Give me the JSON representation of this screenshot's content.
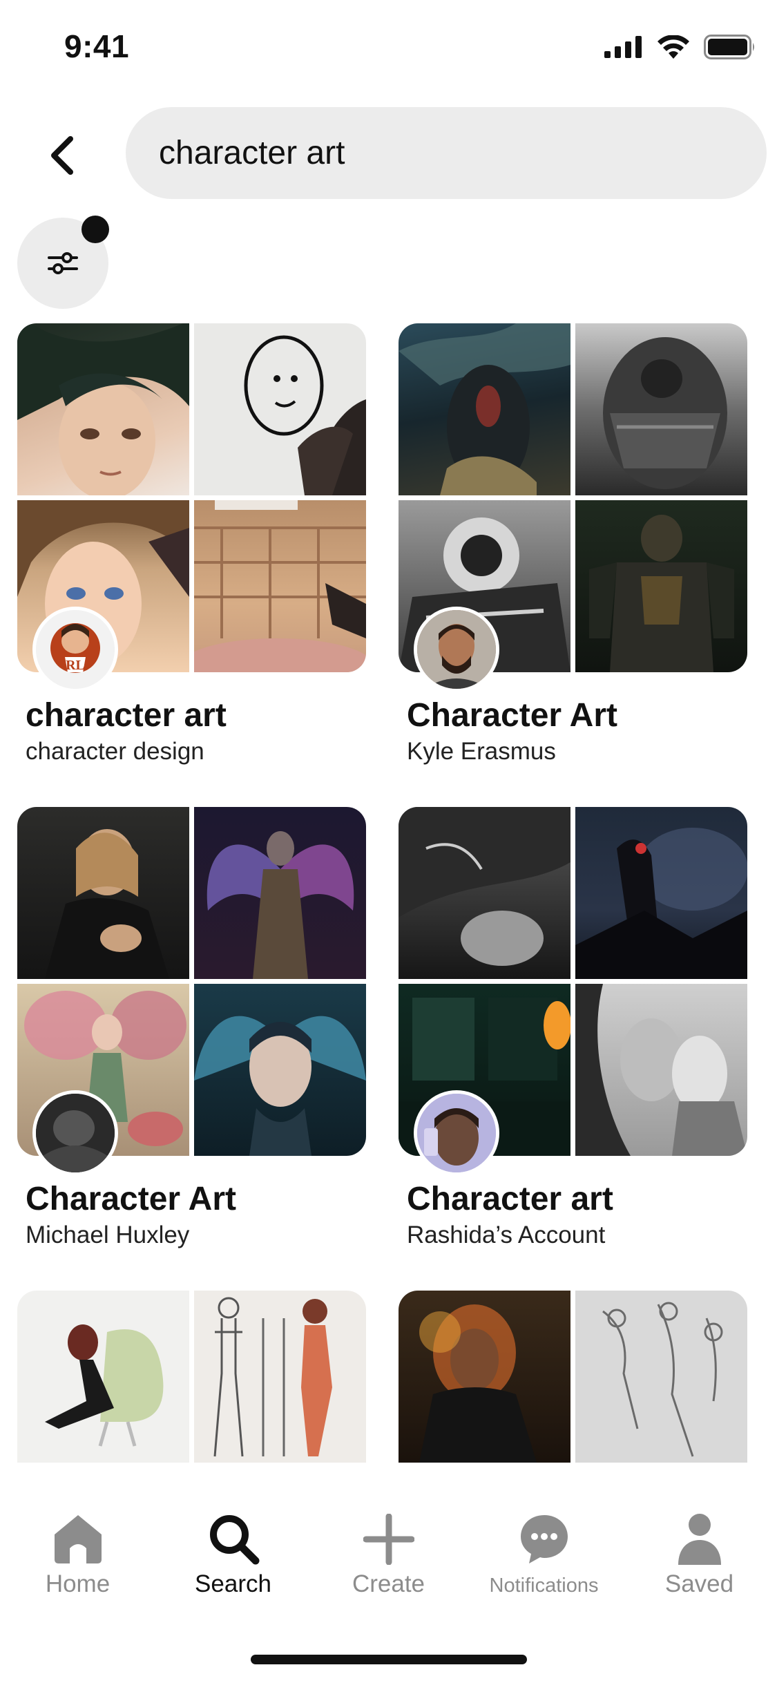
{
  "status_bar": {
    "time": "9:41"
  },
  "search": {
    "query": "character art"
  },
  "boards": [
    {
      "title": "character art",
      "subtitle": "character design"
    },
    {
      "title": "Character Art",
      "subtitle": "Kyle Erasmus"
    },
    {
      "title": "Character Art",
      "subtitle": "Michael Huxley"
    },
    {
      "title": "Character art",
      "subtitle": "Rashida’s Account"
    },
    {
      "title": "",
      "subtitle": ""
    },
    {
      "title": "",
      "subtitle": ""
    }
  ],
  "tab_bar": {
    "items": [
      {
        "label": "Home",
        "icon": "home-icon",
        "active": false
      },
      {
        "label": "Search",
        "icon": "search-icon",
        "active": true
      },
      {
        "label": "Create",
        "icon": "plus-icon",
        "active": false
      },
      {
        "label": "Notifications",
        "icon": "chat-bubble-icon",
        "active": false
      },
      {
        "label": "Saved",
        "icon": "person-icon",
        "active": false
      }
    ]
  },
  "colors": {
    "background": "#ffffff",
    "pill": "#ececec",
    "active_text": "#111111",
    "inactive_tab": "#8c8c8c"
  }
}
